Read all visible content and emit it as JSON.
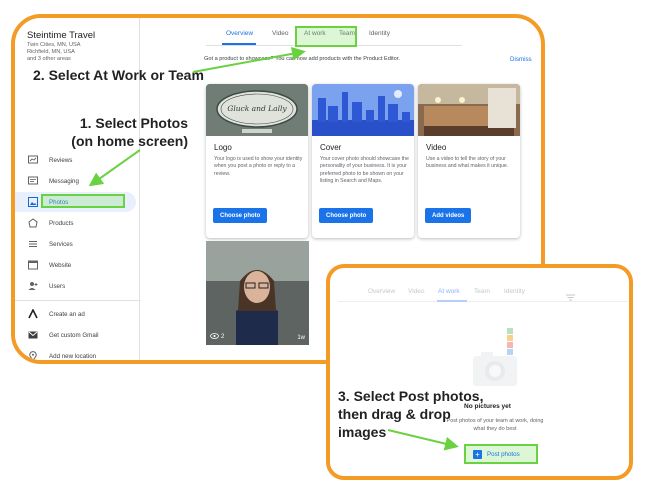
{
  "business": {
    "name": "Steintime Travel",
    "address": "Twin Cities, MN, USA\nRichfield, MN, USA\nand 3 other areas"
  },
  "sidebar": {
    "items": [
      {
        "label": "Reviews",
        "icon": "reviews-icon"
      },
      {
        "label": "Messaging",
        "icon": "messaging-icon"
      },
      {
        "label": "Photos",
        "icon": "photos-icon",
        "active": true
      },
      {
        "label": "Products",
        "icon": "products-icon"
      },
      {
        "label": "Services",
        "icon": "services-icon"
      },
      {
        "label": "Website",
        "icon": "website-icon"
      },
      {
        "label": "Users",
        "icon": "users-icon"
      }
    ],
    "bottom_items": [
      {
        "label": "Create an ad",
        "icon": "ads-icon"
      },
      {
        "label": "Get custom Gmail",
        "icon": "gmail-icon"
      },
      {
        "label": "Add new location",
        "icon": "location-icon"
      }
    ]
  },
  "tabs": [
    "Overview",
    "Video",
    "At work",
    "Team",
    "Identity"
  ],
  "banner": {
    "text": "Got a product to showcase? You can now add products with the Product Editor.",
    "dismiss": "Dismiss"
  },
  "cards": [
    {
      "title": "Logo",
      "desc": "Your logo is used to show your identity when you post a photo or reply to a review.",
      "button": "Choose photo",
      "sign_text": "Gluck and Lally"
    },
    {
      "title": "Cover",
      "desc": "Your cover photo should showcase the personality of your business. It is your preferred photo to be shown on your listing in Search and Maps.",
      "button": "Choose photo"
    },
    {
      "title": "Video",
      "desc": "Use a video to tell the story of your business and what makes it unique.",
      "button": "Add videos"
    }
  ],
  "photo_tile": {
    "views": "2",
    "age": "1w"
  },
  "second_panel": {
    "tabs": [
      "Overview",
      "Video",
      "At work",
      "Team",
      "Identity"
    ],
    "empty_title": "No pictures yet",
    "empty_desc": "Post photos of your team at work, doing what they do best",
    "post_button": "Post photos"
  },
  "callouts": {
    "step1": "1. Select Photos (on home screen)",
    "step2": "2. Select At Work or Team",
    "step3": "3. Select Post photos, then drag & drop images"
  },
  "colors": {
    "accent": "#1a73e8",
    "frame": "#f39b25",
    "highlight": "#6ad142"
  }
}
